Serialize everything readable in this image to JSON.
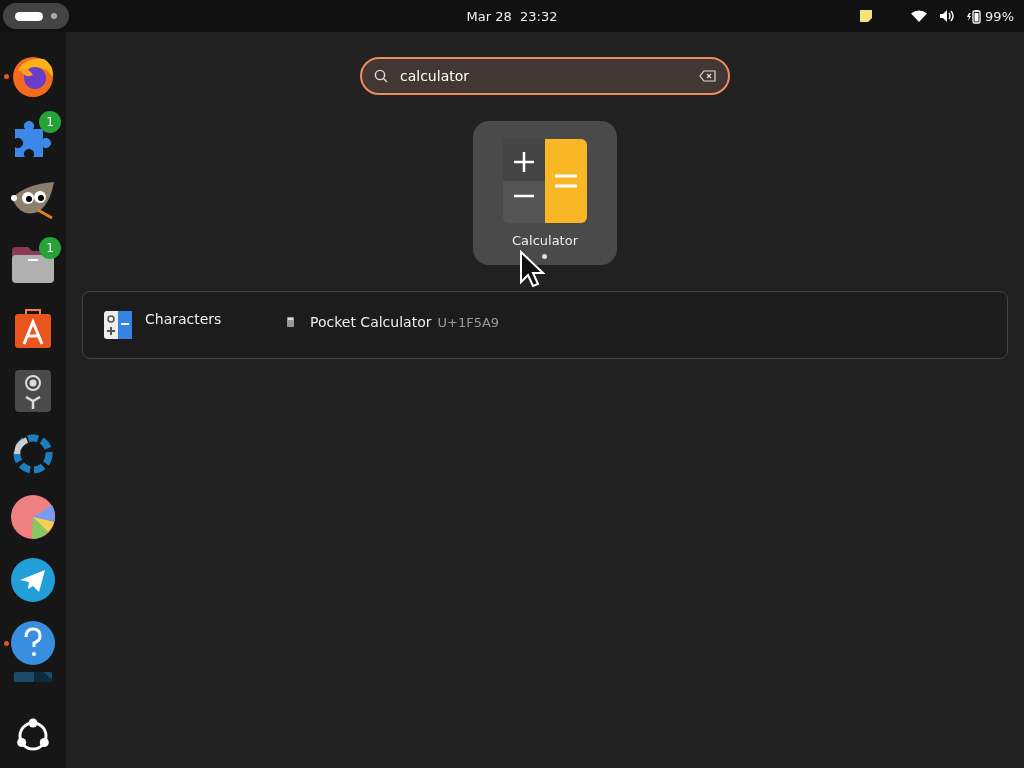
{
  "top_bar": {
    "clock": "Mar 28  23:32",
    "battery": "99%"
  },
  "dock": {
    "items": [
      {
        "kind": "firefox",
        "running": true
      },
      {
        "kind": "extensions",
        "running": false,
        "badge": "1"
      },
      {
        "kind": "gimp",
        "running": false
      },
      {
        "kind": "files",
        "running": false,
        "badge": "1"
      },
      {
        "kind": "appcenter",
        "running": false
      },
      {
        "kind": "webcam",
        "running": false
      },
      {
        "kind": "aperture",
        "running": false
      },
      {
        "kind": "piechart",
        "running": false
      },
      {
        "kind": "telegram",
        "running": false
      },
      {
        "kind": "help",
        "running": true
      },
      {
        "kind": "partial",
        "running": false
      }
    ]
  },
  "search": {
    "value": "calculator"
  },
  "apps": [
    {
      "name": "Calculator",
      "selected": true,
      "running": true
    }
  ],
  "provider_results": [
    {
      "provider": "Characters",
      "items": [
        {
          "name": "Pocket Calculator",
          "code": "U+1F5A9"
        }
      ]
    }
  ]
}
